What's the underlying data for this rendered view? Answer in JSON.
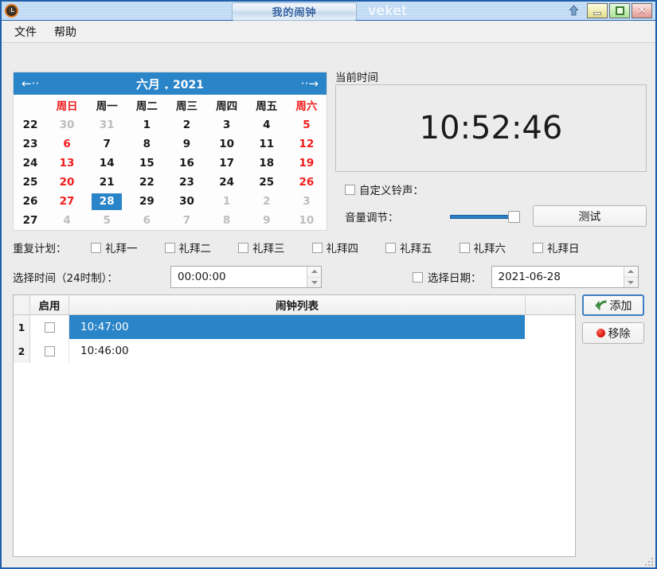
{
  "window": {
    "app_icon": "alarm-clock-icon",
    "tab_title": "我的闹钟",
    "app_name": "veket",
    "rollup_icon": "roll-up-arrow-icon",
    "minimize_icon": "minimize-icon",
    "maximize_icon": "maximize-icon",
    "close_icon": "close-icon",
    "close_glyph": "✕"
  },
  "menubar": {
    "items": [
      {
        "label": "文件"
      },
      {
        "label": "帮助"
      }
    ]
  },
  "calendar": {
    "prev_label": "←··",
    "next_label": "··→",
    "month": "六月",
    "caret": "▾",
    "year": "2021",
    "week_col_header": "",
    "day_headers": [
      {
        "label": "周日",
        "weekend": true
      },
      {
        "label": "周一",
        "weekend": false
      },
      {
        "label": "周二",
        "weekend": false
      },
      {
        "label": "周三",
        "weekend": false
      },
      {
        "label": "周四",
        "weekend": false
      },
      {
        "label": "周五",
        "weekend": false
      },
      {
        "label": "周六",
        "weekend": true
      }
    ],
    "weeks": [
      {
        "num": "22",
        "days": [
          {
            "d": "30",
            "cls": "other"
          },
          {
            "d": "31",
            "cls": "other"
          },
          {
            "d": "1",
            "cls": ""
          },
          {
            "d": "2",
            "cls": ""
          },
          {
            "d": "3",
            "cls": ""
          },
          {
            "d": "4",
            "cls": ""
          },
          {
            "d": "5",
            "cls": "weekend"
          }
        ]
      },
      {
        "num": "23",
        "days": [
          {
            "d": "6",
            "cls": "weekend"
          },
          {
            "d": "7",
            "cls": ""
          },
          {
            "d": "8",
            "cls": ""
          },
          {
            "d": "9",
            "cls": ""
          },
          {
            "d": "10",
            "cls": ""
          },
          {
            "d": "11",
            "cls": ""
          },
          {
            "d": "12",
            "cls": "weekend"
          }
        ]
      },
      {
        "num": "24",
        "days": [
          {
            "d": "13",
            "cls": "weekend"
          },
          {
            "d": "14",
            "cls": ""
          },
          {
            "d": "15",
            "cls": ""
          },
          {
            "d": "16",
            "cls": ""
          },
          {
            "d": "17",
            "cls": ""
          },
          {
            "d": "18",
            "cls": ""
          },
          {
            "d": "19",
            "cls": "weekend"
          }
        ]
      },
      {
        "num": "25",
        "days": [
          {
            "d": "20",
            "cls": "weekend"
          },
          {
            "d": "21",
            "cls": ""
          },
          {
            "d": "22",
            "cls": ""
          },
          {
            "d": "23",
            "cls": ""
          },
          {
            "d": "24",
            "cls": ""
          },
          {
            "d": "25",
            "cls": ""
          },
          {
            "d": "26",
            "cls": "weekend"
          }
        ]
      },
      {
        "num": "26",
        "days": [
          {
            "d": "27",
            "cls": "weekend"
          },
          {
            "d": "28",
            "cls": "selected"
          },
          {
            "d": "29",
            "cls": ""
          },
          {
            "d": "30",
            "cls": ""
          },
          {
            "d": "1",
            "cls": "other"
          },
          {
            "d": "2",
            "cls": "other"
          },
          {
            "d": "3",
            "cls": "other"
          }
        ]
      },
      {
        "num": "27",
        "days": [
          {
            "d": "4",
            "cls": "other"
          },
          {
            "d": "5",
            "cls": "other"
          },
          {
            "d": "6",
            "cls": "other"
          },
          {
            "d": "7",
            "cls": "other"
          },
          {
            "d": "8",
            "cls": "other"
          },
          {
            "d": "9",
            "cls": "other"
          },
          {
            "d": "10",
            "cls": "other"
          }
        ]
      }
    ],
    "selected_day": "28",
    "header_color": "#2a84c8",
    "weekend_color": "#f01b1b"
  },
  "current_time": {
    "group_label": "当前时间",
    "clock": "10:52:46"
  },
  "ringtone": {
    "checkbox_checked": false,
    "label": "自定义铃声："
  },
  "volume": {
    "label": "音量调节：",
    "value": 100,
    "test_button": "测试"
  },
  "repeat": {
    "title": "重复计划：",
    "days": [
      {
        "label": "礼拜一",
        "checked": false
      },
      {
        "label": "礼拜二",
        "checked": false
      },
      {
        "label": "礼拜三",
        "checked": false
      },
      {
        "label": "礼拜四",
        "checked": false
      },
      {
        "label": "礼拜五",
        "checked": false
      },
      {
        "label": "礼拜六",
        "checked": false
      },
      {
        "label": "礼拜日",
        "checked": false
      }
    ]
  },
  "time_select": {
    "label": "选择时间（24时制）：",
    "value": "00:00:00"
  },
  "date_select": {
    "checked": false,
    "label": "选择日期：",
    "value": "2021-06-28"
  },
  "alarm_list": {
    "header_enable": "启用",
    "header_title": "闹钟列表",
    "rows": [
      {
        "num": "1",
        "checked": false,
        "time": "10:47:00",
        "selected": true
      },
      {
        "num": "2",
        "checked": false,
        "time": "10:46:00",
        "selected": false
      }
    ]
  },
  "side_buttons": {
    "add_label": "添加",
    "add_icon": "green-arrow-icon",
    "remove_label": "移除",
    "remove_icon": "red-circle-icon"
  }
}
